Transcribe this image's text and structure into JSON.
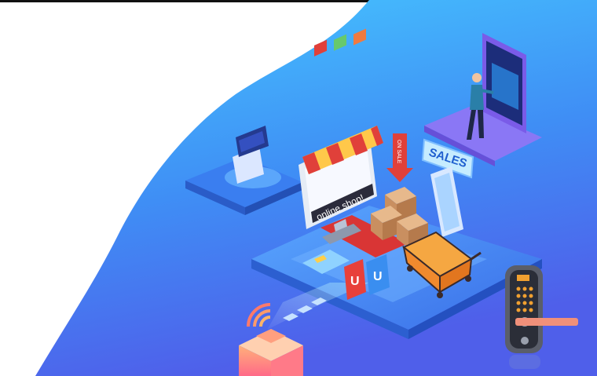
{
  "illustration": {
    "shop_sign": "online shop!",
    "sale_sign": "SALES",
    "arrow_text": "ON SALE",
    "bag_letter": "U"
  },
  "colors": {
    "bg_light": "#4fc3ff",
    "bg_dark": "#4a6cf0",
    "platform": "#3d7ff2",
    "awning_red": "#e0403a",
    "awning_yellow": "#ffc84a",
    "accent_orange": "#f5a742"
  }
}
